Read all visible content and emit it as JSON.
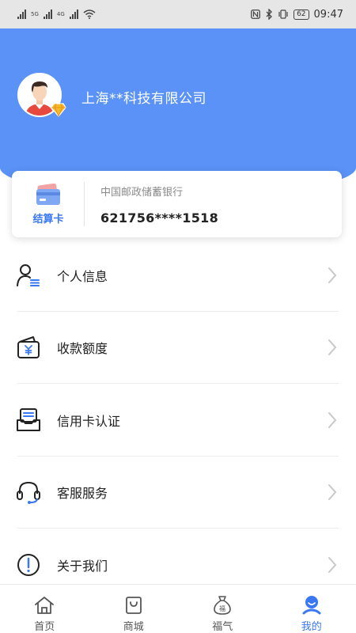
{
  "status_bar": {
    "network_1": "5G",
    "network_2": "4G",
    "battery": "62",
    "time": "09:47"
  },
  "header": {
    "company_name": "上海**科技有限公司"
  },
  "card": {
    "type_label": "结算卡",
    "bank_name": "中国邮政储蓄银行",
    "card_number": "621756****1518"
  },
  "menu": {
    "items": [
      {
        "label": "个人信息",
        "icon": "user-info-icon"
      },
      {
        "label": "收款额度",
        "icon": "wallet-icon"
      },
      {
        "label": "信用卡认证",
        "icon": "credit-card-verify-icon"
      },
      {
        "label": "客服服务",
        "icon": "headset-icon"
      },
      {
        "label": "关于我们",
        "icon": "info-icon"
      }
    ]
  },
  "tabbar": {
    "tabs": [
      {
        "label": "首页",
        "icon": "home-icon"
      },
      {
        "label": "商城",
        "icon": "shopping-bag-icon"
      },
      {
        "label": "福气",
        "icon": "fortune-bag-icon"
      },
      {
        "label": "我的",
        "icon": "profile-icon",
        "active": true
      }
    ]
  },
  "colors": {
    "accent": "#3a78f2",
    "header_bg": "#5b92f7"
  }
}
